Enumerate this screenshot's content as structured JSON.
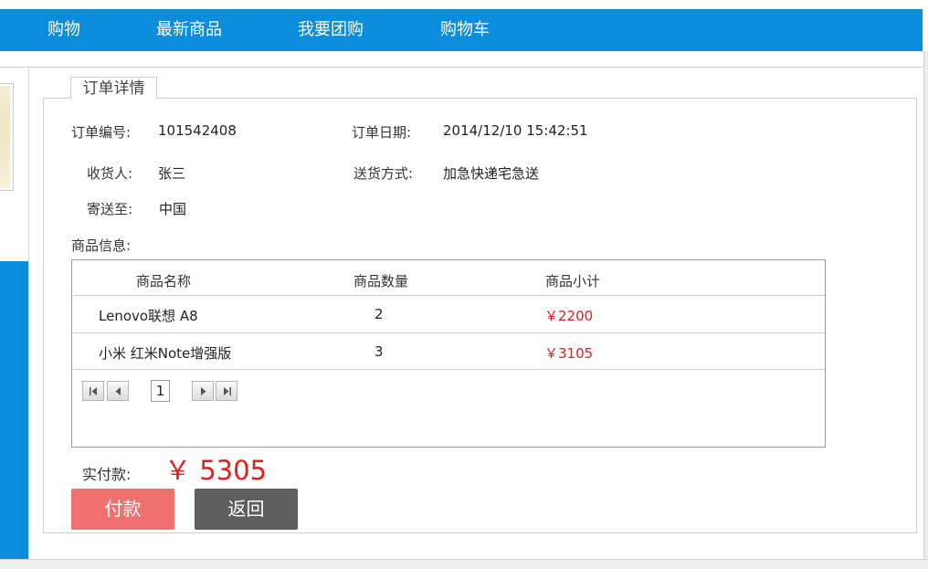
{
  "nav": {
    "items": [
      "购物",
      "最新商品",
      "我要团购",
      "购物车"
    ]
  },
  "order": {
    "legend": "订单详情",
    "number_label": "订单编号:",
    "number_value": "101542408",
    "date_label": "订单日期:",
    "date_value": "2014/12/10 15:42:51",
    "receiver_label": "收货人:",
    "receiver_value": "张三",
    "shipping_label": "送货方式:",
    "shipping_value": "加急快递宅急送",
    "destination_label": "寄送至:",
    "destination_value": "中国",
    "goods_label": "商品信息:"
  },
  "table": {
    "headers": [
      "商品名称",
      "商品数量",
      "商品小计"
    ],
    "rows": [
      {
        "name": "Lenovo联想 A8",
        "qty": "2",
        "subtotal": "￥2200"
      },
      {
        "name": "小米 红米Note增强版",
        "qty": "3",
        "subtotal": "￥3105"
      }
    ],
    "pager": {
      "page": "1"
    }
  },
  "total": {
    "label": "实付款:",
    "value": "￥ 5305"
  },
  "buttons": {
    "pay": "付款",
    "back": "返回"
  },
  "colors": {
    "nav_bg": "#0a8ddc",
    "price": "#e0211b",
    "pay_button": "#f07070",
    "back_button": "#5e5e5e"
  }
}
